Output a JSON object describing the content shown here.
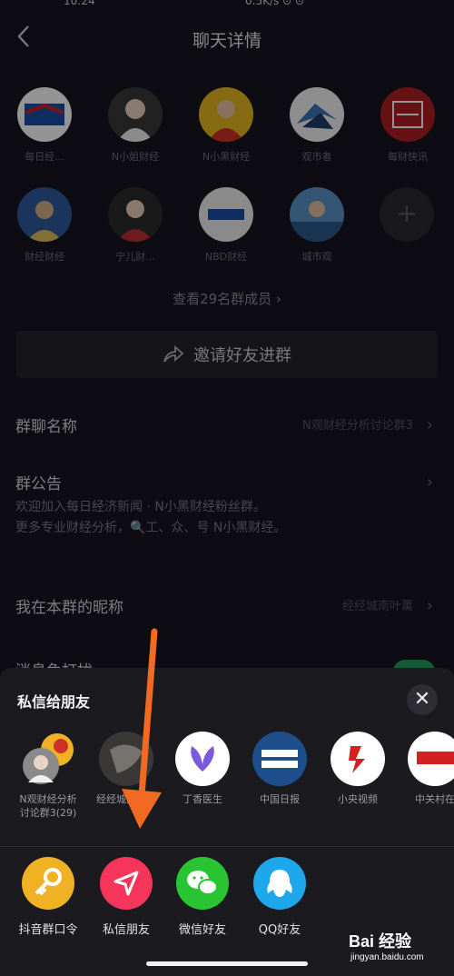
{
  "statusbar": {
    "time": "10:24",
    "right": "0.5K/s ⊙ ⊙"
  },
  "header": {
    "title": "聊天详情"
  },
  "members": [
    {
      "name": "每日经...",
      "color": "#1c4fa8"
    },
    {
      "name": "N小姐财经",
      "color": "#d9d0c8"
    },
    {
      "name": "N小黑财经",
      "color": "#d0302a"
    },
    {
      "name": "观市者",
      "color": "#4a8fc4"
    },
    {
      "name": "每财快讯",
      "color": "#b01e22"
    },
    {
      "name": "财经财经",
      "color": "#2e5a9e"
    },
    {
      "name": "宁儿财...",
      "color": "#c03030"
    },
    {
      "name": "NBD财经",
      "color": "#e8e8e8"
    },
    {
      "name": "城市观",
      "color": "#3a78b8"
    }
  ],
  "see_all": "查看29名群成员",
  "invite_label": "邀请好友进群",
  "settings": {
    "group_name_label": "群聊名称",
    "group_name_value": "N观财经分析讨论群3",
    "notice_label": "群公告",
    "notice_line1": "欢迎加入每日经济新闻 · N小黑财经粉丝群。",
    "notice_line2": "更多专业财经分析，🔍工、众、号 N小黑财经。",
    "nickname_label": "我在本群的昵称",
    "nickname_value": "经经城南叶薰",
    "mute_label": "消息免打扰"
  },
  "sheet": {
    "title": "私信给朋友",
    "close": "✕",
    "friends": [
      {
        "name_line1": "N观财经分析",
        "name_line2": "讨论群3(29)",
        "color": "#d8c6b0"
      },
      {
        "name_line1": "经经城南叶薰",
        "name_line2": "",
        "color": "#55504c"
      },
      {
        "name_line1": "丁香医生",
        "name_line2": "",
        "color": "#ffffff"
      },
      {
        "name_line1": "中国日报",
        "name_line2": "",
        "color": "#1e4e8c"
      },
      {
        "name_line1": "小央视频",
        "name_line2": "",
        "color": "#ffffff"
      },
      {
        "name_line1": "中关村在",
        "name_line2": "",
        "color": "#ffffff"
      }
    ],
    "share": [
      {
        "label": "抖音群口令",
        "color": "#f0b224"
      },
      {
        "label": "私信朋友",
        "color": "#f5355a"
      },
      {
        "label": "微信好友",
        "color": "#29c431"
      },
      {
        "label": "QQ好友",
        "color": "#1ea7ea"
      }
    ]
  },
  "watermark": {
    "logo": "Bai 经验",
    "url": "jingyan.baidu.com"
  }
}
